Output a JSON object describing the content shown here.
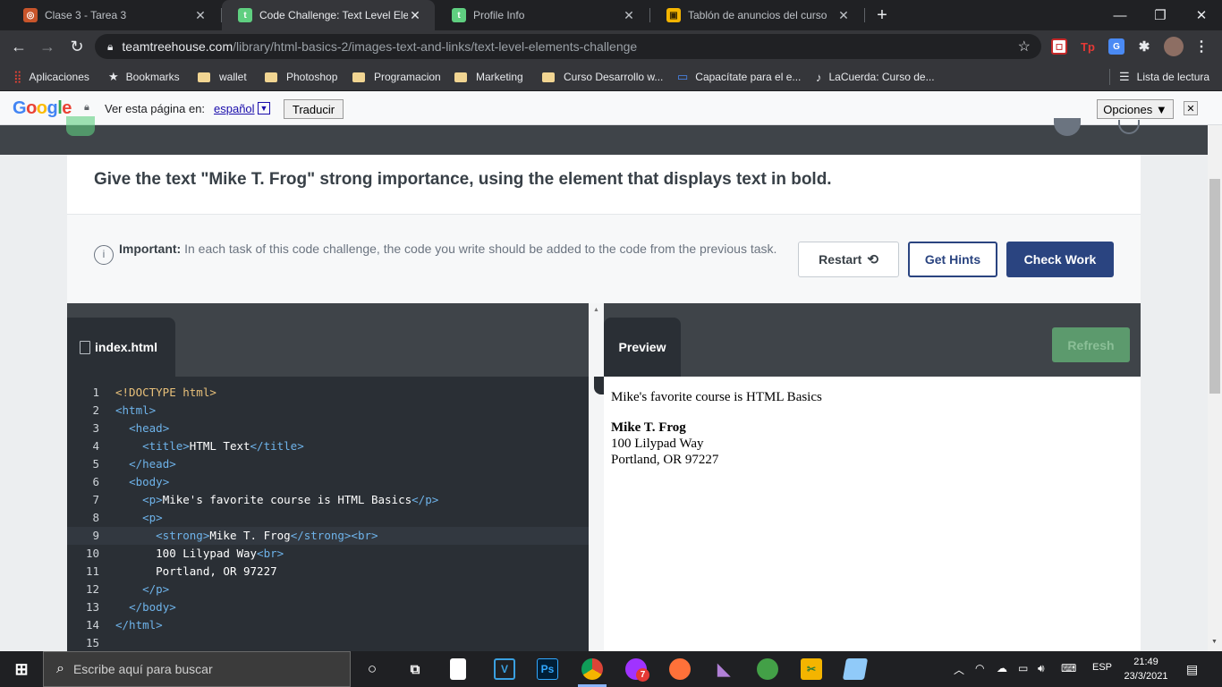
{
  "browser": {
    "tabs": [
      {
        "title": "Clase 3 - Tarea 3",
        "active": false,
        "favicon_color": "#f4a460"
      },
      {
        "title": "Code Challenge: Text Level Eleme",
        "active": true,
        "favicon_color": "#5fcf80"
      },
      {
        "title": "Profile Info",
        "active": false,
        "favicon_color": "#5fcf80"
      },
      {
        "title": "Tablón de anuncios del curso",
        "active": false,
        "favicon_color": "#f4b400"
      }
    ],
    "new_tab": "+",
    "url_host": "teamtreehouse.com",
    "url_path": "/library/html-basics-2/images-text-and-links/text-level-elements-challenge",
    "bookmarks": [
      {
        "label": "Aplicaciones",
        "icon": "apps-grid-icon"
      },
      {
        "label": "Bookmarks",
        "icon": "star-icon"
      },
      {
        "label": "wallet",
        "icon": "folder-icon"
      },
      {
        "label": "Photoshop",
        "icon": "folder-icon"
      },
      {
        "label": "Programacion",
        "icon": "folder-icon"
      },
      {
        "label": "Marketing",
        "icon": "folder-icon"
      },
      {
        "label": "Curso Desarrollo w...",
        "icon": "folder-icon"
      },
      {
        "label": "Capacítate para el e...",
        "icon": "page-icon"
      },
      {
        "label": "LaCuerda: Curso de...",
        "icon": "guitar-icon"
      }
    ],
    "reading_list": "Lista de lectura"
  },
  "translate_bar": {
    "logo": "Google",
    "prompt": "Ver esta página en:",
    "language": "español",
    "translate_button": "Traducir",
    "options_button": "Opciones ▼"
  },
  "challenge": {
    "task": "Give the text \"Mike T. Frog\" strong importance, using the element that displays text in bold.",
    "important_label": "Important:",
    "important_text": " In each task of this code challenge, the code you write should be added to the code from the previous task.",
    "restart": "Restart",
    "get_hints": "Get Hints",
    "check_work": "Check Work"
  },
  "editor": {
    "filename": "index.html",
    "highlighted_line": 9,
    "lines": [
      {
        "n": "1",
        "indent": "",
        "tokens": [
          [
            "dt",
            "<!DOCTYPE html>"
          ]
        ]
      },
      {
        "n": "2",
        "indent": "",
        "tokens": [
          [
            "tg",
            "<html>"
          ]
        ]
      },
      {
        "n": "3",
        "indent": "  ",
        "tokens": [
          [
            "tg",
            "<head>"
          ]
        ]
      },
      {
        "n": "4",
        "indent": "    ",
        "tokens": [
          [
            "tg",
            "<title>"
          ],
          [
            "tx",
            "HTML Text"
          ],
          [
            "tg",
            "</title>"
          ]
        ]
      },
      {
        "n": "5",
        "indent": "  ",
        "tokens": [
          [
            "tg",
            "</head>"
          ]
        ]
      },
      {
        "n": "6",
        "indent": "  ",
        "tokens": [
          [
            "tg",
            "<body>"
          ]
        ]
      },
      {
        "n": "7",
        "indent": "    ",
        "tokens": [
          [
            "tg",
            "<p>"
          ],
          [
            "tx",
            "Mike's favorite course is HTML Basics"
          ],
          [
            "tg",
            "</p>"
          ]
        ]
      },
      {
        "n": "8",
        "indent": "    ",
        "tokens": [
          [
            "tg",
            "<p>"
          ]
        ]
      },
      {
        "n": "9",
        "indent": "      ",
        "tokens": [
          [
            "tg",
            "<strong>"
          ],
          [
            "tx",
            "Mike T. Frog"
          ],
          [
            "tg",
            "</strong><br>"
          ]
        ]
      },
      {
        "n": "10",
        "indent": "      ",
        "tokens": [
          [
            "tx",
            "100 Lilypad Way"
          ],
          [
            "tg",
            "<br>"
          ]
        ]
      },
      {
        "n": "11",
        "indent": "      ",
        "tokens": [
          [
            "tx",
            "Portland, OR 97227"
          ]
        ]
      },
      {
        "n": "12",
        "indent": "    ",
        "tokens": [
          [
            "tg",
            "</p>"
          ]
        ]
      },
      {
        "n": "13",
        "indent": "  ",
        "tokens": [
          [
            "tg",
            "</body>"
          ]
        ]
      },
      {
        "n": "14",
        "indent": "",
        "tokens": [
          [
            "tg",
            "</html>"
          ]
        ]
      },
      {
        "n": "15",
        "indent": "",
        "tokens": []
      }
    ]
  },
  "preview": {
    "tab": "Preview",
    "refresh": "Refresh",
    "paragraph": "Mike's favorite course is HTML Basics",
    "name": "Mike T. Frog",
    "street": "100 Lilypad Way",
    "city": "Portland, OR 97227"
  },
  "taskbar": {
    "search_placeholder": "Escribe aquí para buscar",
    "language": "ESP",
    "time": "21:49",
    "date": "23/3/2021",
    "messenger_badge": "7"
  },
  "colors": {
    "accent_navy": "#2a4480",
    "code_tag": "#6eb3ea",
    "code_doctype": "#e8c07a",
    "refresh_green": "#5c9a6d"
  }
}
